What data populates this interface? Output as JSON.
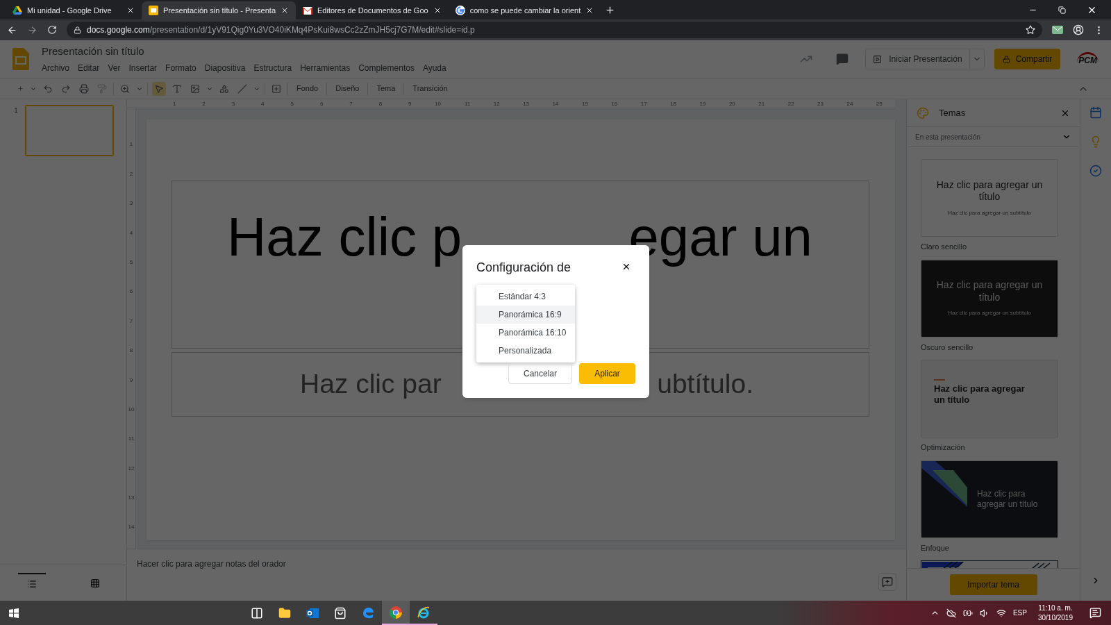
{
  "browser": {
    "tabs": [
      {
        "title": "Mi unidad - Google Drive",
        "kind": "drive",
        "selected": false
      },
      {
        "title": "Presentación sin título - Presenta",
        "kind": "slides",
        "selected": true
      },
      {
        "title": "Editores de Documentos de Goo",
        "kind": "gmail",
        "selected": false
      },
      {
        "title": "como se puede cambiar la orient",
        "kind": "google",
        "selected": false
      }
    ],
    "url_host": "docs.google.com",
    "url_path": "/presentation/d/1yV91Qig0Yu3VO40iKMq4PsKui8wsCc2zZmJH5cj7G7M/edit#slide=id.p"
  },
  "app": {
    "title": "Presentación sin título",
    "menu": [
      "Archivo",
      "Editar",
      "Ver",
      "Insertar",
      "Formato",
      "Diapositiva",
      "Estructura",
      "Herramientas",
      "Complementos",
      "Ayuda"
    ],
    "present_button": "Iniciar Presentación",
    "share_button": "Compartir",
    "logo_text": "PCM",
    "toolbar_text": [
      "Fondo",
      "Diseño",
      "Tema",
      "Transición"
    ]
  },
  "ruler": {
    "horizontal": [
      "1",
      "2",
      "3",
      "4",
      "5",
      "6",
      "7",
      "8",
      "9",
      "10",
      "11",
      "12",
      "13",
      "14",
      "15",
      "16",
      "17",
      "18",
      "19",
      "20",
      "21",
      "22",
      "23",
      "24",
      "25"
    ],
    "vertical": [
      "1",
      "2",
      "3",
      "4",
      "5",
      "6",
      "7",
      "8",
      "9",
      "10",
      "11",
      "12",
      "13",
      "14"
    ]
  },
  "filmstrip": [
    {
      "number": "1",
      "selected": true
    }
  ],
  "views": [
    {
      "kind": "list",
      "selected": true
    },
    {
      "kind": "grid",
      "selected": false
    }
  ],
  "slide": {
    "title_parts": [
      "Haz clic p",
      "egar un"
    ],
    "subtitle_parts": [
      "Haz clic par",
      "ubtítulo."
    ]
  },
  "notes": {
    "placeholder": "Hacer clic para agregar notas del orador"
  },
  "themes": {
    "title": "Temas",
    "filter": "En esta presentación",
    "import_button": "Importar tema",
    "cards": [
      {
        "kind": "light",
        "title": "Haz clic para agregar un título",
        "subtitle": "Haz clic para agregar un subtítulo",
        "label": "Claro sencillo"
      },
      {
        "kind": "dark",
        "title": "Haz clic para agregar un título",
        "subtitle": "Haz clic para agregar un subtítulo",
        "label": "Oscuro sencillo"
      },
      {
        "kind": "optimization",
        "title": "Haz clic para agregar un título",
        "label": "Optimización"
      },
      {
        "kind": "focus",
        "title": "Haz clic para agregar un título",
        "label": "Enfoque"
      },
      {
        "kind": "lines"
      }
    ]
  },
  "dialog": {
    "title": "Configuración de",
    "options": [
      {
        "label": "Estándar 4:3",
        "selected": false
      },
      {
        "label": "Panorámica 16:9",
        "selected": true
      },
      {
        "label": "Panorámica 16:10",
        "selected": false
      },
      {
        "label": "Personalizada",
        "selected": false
      }
    ],
    "cancel": "Cancelar",
    "apply": "Aplicar"
  },
  "taskbar": {
    "apps": [
      {
        "kind": "taskview",
        "selected": false
      },
      {
        "kind": "explorer",
        "selected": false
      },
      {
        "kind": "outlook",
        "selected": false
      },
      {
        "kind": "store",
        "selected": false
      },
      {
        "kind": "edge",
        "selected": false
      },
      {
        "kind": "chrome",
        "selected": true
      },
      {
        "kind": "ie",
        "selected": true
      }
    ],
    "language": "ESP",
    "time": "11:10 a. m.",
    "date": "30/10/2019"
  }
}
